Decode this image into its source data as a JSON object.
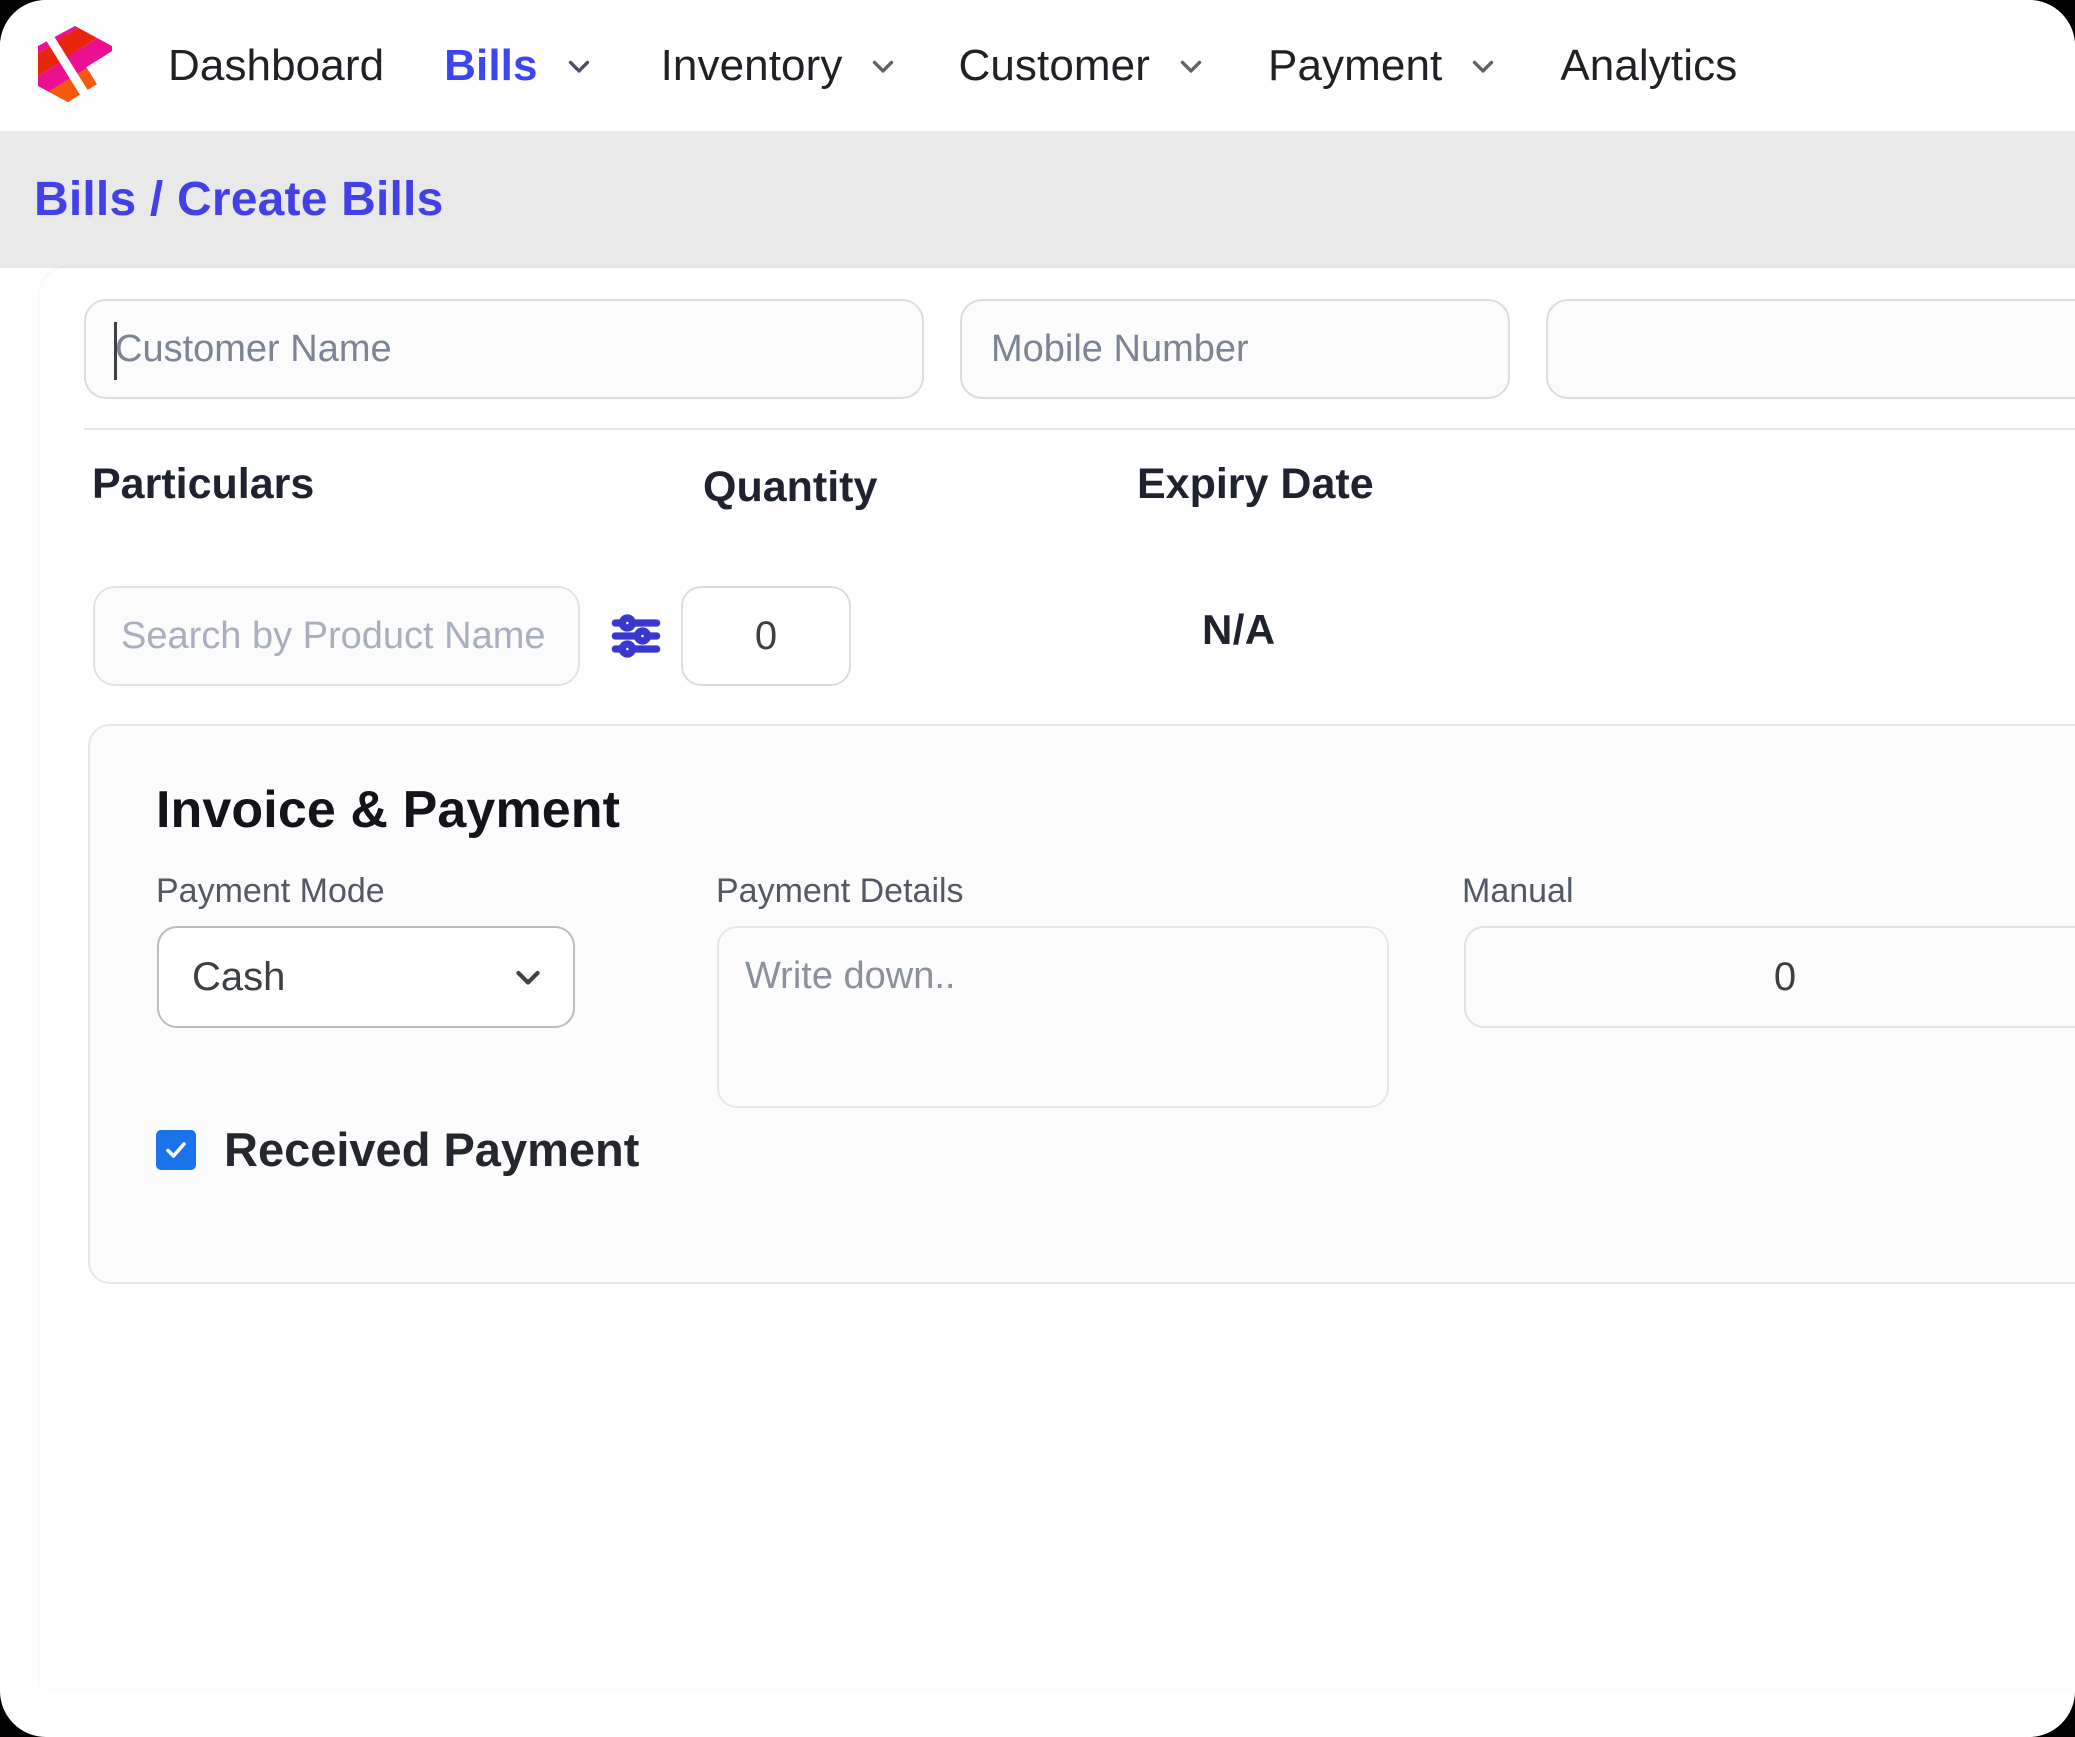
{
  "nav": {
    "logo_icon": "hexagon-stripes-logo",
    "items": [
      {
        "label": "Dashboard",
        "has_dropdown": false,
        "active": false
      },
      {
        "label": "Bills",
        "has_dropdown": true,
        "active": true
      },
      {
        "label": "Inventory",
        "has_dropdown": true,
        "active": false
      },
      {
        "label": "Customer",
        "has_dropdown": true,
        "active": false
      },
      {
        "label": "Payment",
        "has_dropdown": true,
        "active": false
      },
      {
        "label": "Analytics",
        "has_dropdown": false,
        "active": false
      }
    ]
  },
  "breadcrumb": {
    "text": "Bills / Create Bills",
    "color": "#4340e8"
  },
  "form": {
    "customer_name": {
      "placeholder": "Customer Name",
      "value": "",
      "focused": true
    },
    "mobile_number": {
      "placeholder": "Mobile Number",
      "value": ""
    },
    "third_field": {
      "placeholder": "",
      "value": ""
    }
  },
  "table": {
    "columns": [
      "Particulars",
      "Quantity",
      "Expiry Date"
    ],
    "rows": [
      {
        "product_search_placeholder": "Search by Product Name",
        "product_search_value": "",
        "filter_icon": "sliders-filter-icon",
        "quantity": "0",
        "expiry_date": "N/A"
      }
    ]
  },
  "invoice": {
    "title": "Invoice & Payment",
    "payment_mode": {
      "label": "Payment Mode",
      "selected": "Cash",
      "options": [
        "Cash"
      ]
    },
    "payment_details": {
      "label": "Payment Details",
      "placeholder": "Write down..",
      "value": ""
    },
    "manual": {
      "label": "Manual",
      "value": "0"
    },
    "received_payment": {
      "label": "Received Payment",
      "checked": true,
      "color": "#1a73e8"
    }
  }
}
